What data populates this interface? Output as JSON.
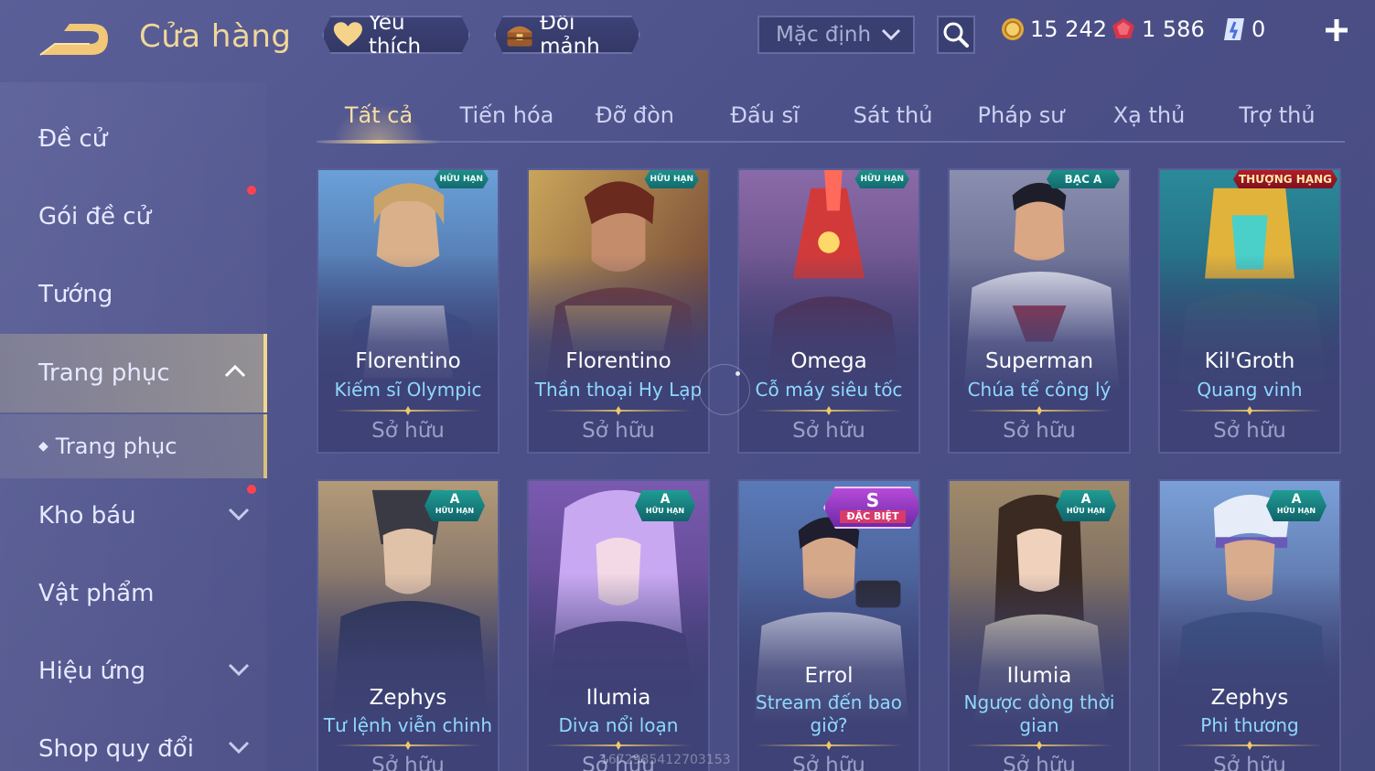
{
  "header": {
    "title": "Cửa hàng",
    "favorites_label": "Yêu thích",
    "exchange_label": "Đổi mảnh",
    "sort_value": "Mặc định",
    "currency": {
      "gold": "15 242",
      "voucher": "1 586",
      "fragment": "0"
    }
  },
  "sidebar": {
    "items": [
      {
        "label": "Đề cử"
      },
      {
        "label": "Gói đề cử"
      },
      {
        "label": "Tướng"
      },
      {
        "label": "Trang phục"
      },
      {
        "label": "Trang phục"
      },
      {
        "label": "Kho báu"
      },
      {
        "label": "Vật phẩm"
      },
      {
        "label": "Hiệu ứng"
      },
      {
        "label": "Shop quy đổi"
      }
    ]
  },
  "tabs": [
    {
      "label": "Tất cả"
    },
    {
      "label": "Tiến hóa"
    },
    {
      "label": "Đỡ đòn"
    },
    {
      "label": "Đấu sĩ"
    },
    {
      "label": "Sát thủ"
    },
    {
      "label": "Pháp sư"
    },
    {
      "label": "Xạ thủ"
    },
    {
      "label": "Trợ thủ"
    }
  ],
  "cards": [
    {
      "hero": "Florentino",
      "skin": "Kiếm sĩ Olympic",
      "status": "Sở hữu",
      "badge": "HỮU HẠN"
    },
    {
      "hero": "Florentino",
      "skin": "Thần thoại Hy Lạp",
      "status": "Sở hữu",
      "badge": "HỮU HẠN"
    },
    {
      "hero": "Omega",
      "skin": "Cỗ máy siêu tốc",
      "status": "Sở hữu",
      "badge": "HỮU HẠN"
    },
    {
      "hero": "Superman",
      "skin": "Chúa tể công lý",
      "status": "Sở hữu",
      "badge": "BẠC A"
    },
    {
      "hero": "Kil'Groth",
      "skin": "Quang vinh",
      "status": "Sở hữu",
      "badge": "THƯỢNG HẠNG"
    },
    {
      "hero": "Zephys",
      "skin": "Tư lệnh viễn chinh",
      "status": "Sở hữu",
      "tier": "A",
      "badge": "HỮU HẠN"
    },
    {
      "hero": "Ilumia",
      "skin": "Diva nổi loạn",
      "status": "Sở hữu",
      "tier": "A",
      "badge": "HỮU HẠN"
    },
    {
      "hero": "Errol",
      "skin": "Stream đến bao giờ?",
      "status": "Sở hữu",
      "tier": "S",
      "badge": "ĐẶC BIỆT"
    },
    {
      "hero": "Ilumia",
      "skin": "Ngược dòng thời gian",
      "status": "Sở hữu",
      "tier": "A",
      "badge": "HỮU HẠN"
    },
    {
      "hero": "Zephys",
      "skin": "Phi thương",
      "status": "Sở hữu",
      "tier": "A",
      "badge": "HỮU HẠN"
    }
  ],
  "watermark": "1672985412703153",
  "colors": {
    "accent_gold": "#f0d79a",
    "skin_name_blue": "#8fd8ff",
    "notification_red": "#ff4250"
  }
}
